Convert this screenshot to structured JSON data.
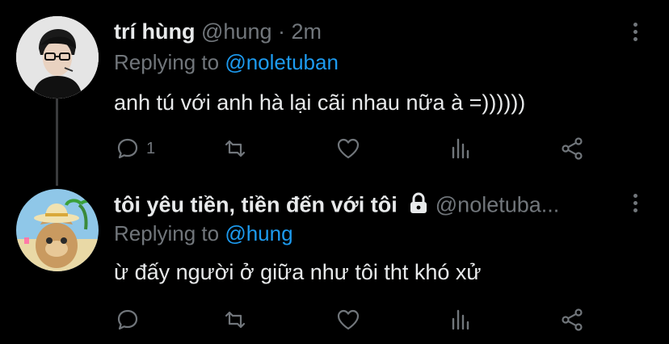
{
  "tweets": [
    {
      "name": "trí hùng",
      "handle": "@hung",
      "separator": "·",
      "time": "2m",
      "replying_prefix": "Replying to",
      "replying_to": "@noletuban",
      "text": "anh tú với anh hà lại cãi nhau nữa à =))))))",
      "reply_count": "1"
    },
    {
      "name": "tôi yêu tiền, tiền đến với tôi",
      "handle": "@noletuba...",
      "replying_prefix": "Replying to",
      "replying_to": "@hung",
      "text": "ừ đấy người ở giữa như tôi tht khó xử",
      "reply_count": ""
    }
  ],
  "icons": {
    "reply": "reply-icon",
    "retweet": "retweet-icon",
    "like": "heart-icon",
    "analytics": "analytics-icon",
    "share": "share-icon",
    "more": "more-options-icon",
    "lock": "lock-icon"
  },
  "colors": {
    "background": "#000000",
    "text": "#e7e9ea",
    "muted": "#71767b",
    "link": "#1d9bf0"
  }
}
